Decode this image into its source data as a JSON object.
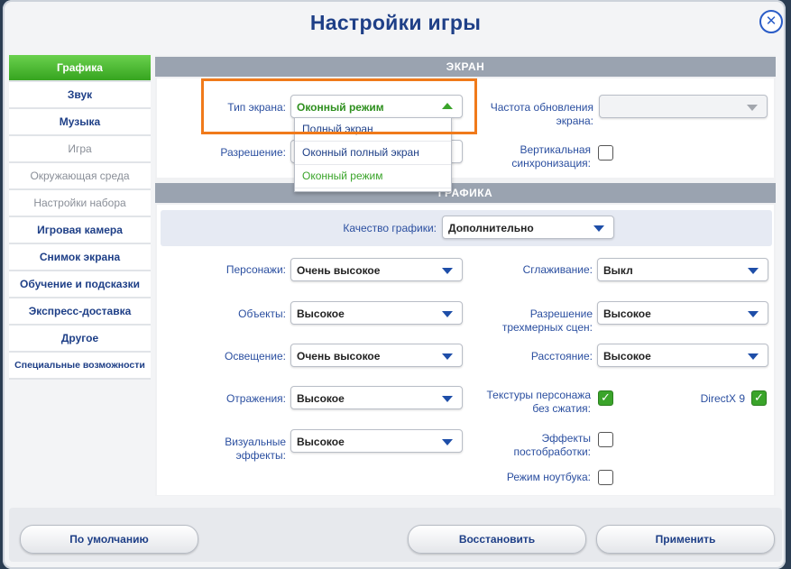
{
  "dialog": {
    "title": "Настройки игры",
    "close": "✕"
  },
  "sidebar": {
    "items": [
      {
        "label": "Графика"
      },
      {
        "label": "Звук"
      },
      {
        "label": "Музыка"
      },
      {
        "label": "Игра"
      },
      {
        "label": "Окружающая среда"
      },
      {
        "label": "Настройки набора"
      },
      {
        "label": "Игровая камера"
      },
      {
        "label": "Снимок экрана"
      },
      {
        "label": "Обучение и подсказки"
      },
      {
        "label": "Экспресс-доставка"
      },
      {
        "label": "Другое"
      },
      {
        "label": "Специальные возможности"
      }
    ],
    "active": "Графика"
  },
  "screen": {
    "header": "ЭКРАН",
    "screen_type_label": "Тип экрана:",
    "screen_type_value": "Оконный режим",
    "resolution_label": "Разрешение:",
    "refresh_label": "Частота обновления экрана:",
    "refresh_value": "",
    "vsync_label": "Вертикальная синхронизация:",
    "vsync_checked": false,
    "options": [
      "Полный экран",
      "Оконный полный экран",
      "Оконный режим"
    ]
  },
  "graphics": {
    "header": "ГРАФИКА",
    "quality_label": "Качество графики:",
    "quality_value": "Дополнительно",
    "sims_label": "Персонажи:",
    "sims_value": "Очень высокое",
    "objects_label": "Объекты:",
    "objects_value": "Высокое",
    "lighting_label": "Освещение:",
    "lighting_value": "Очень высокое",
    "reflections_label": "Отражения:",
    "reflections_value": "Высокое",
    "visual_effects_label": "Визуальные эффекты:",
    "visual_effects_value": "Высокое",
    "aa_label": "Сглаживание:",
    "aa_value": "Выкл",
    "scene_res_label": "Разрешение трехмерных сцен:",
    "scene_res_value": "Высокое",
    "distance_label": "Расстояние:",
    "distance_value": "Высокое",
    "textures_label": "Текстуры персонажа без сжатия:",
    "textures_checked": true,
    "directx_label": "DirectX 9",
    "directx_checked": true,
    "post_label": "Эффекты постобработки:",
    "post_checked": false,
    "laptop_label": "Режим ноутбука:",
    "laptop_checked": false
  },
  "footer": {
    "defaults": "По умолчанию",
    "restore": "Восстановить",
    "apply": "Применить"
  },
  "colors": {
    "accent": "#1e3f87",
    "active_tab": "#4fbf34",
    "highlight": "#f07a1a"
  }
}
